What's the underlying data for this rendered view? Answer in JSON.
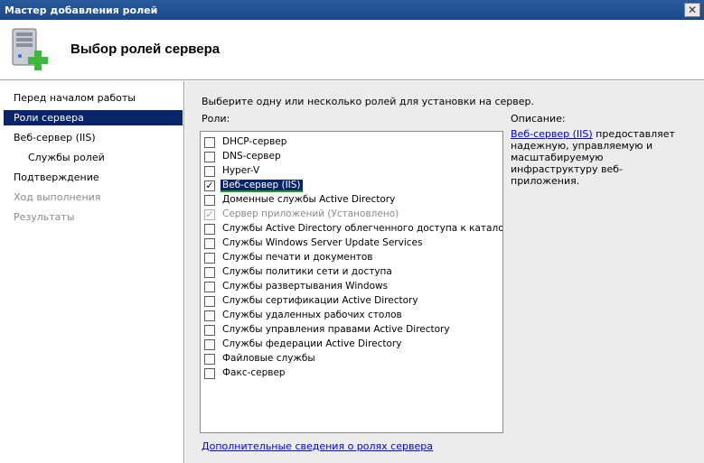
{
  "window": {
    "title": "Мастер добавления ролей",
    "close_glyph": "✕"
  },
  "header": {
    "title": "Выбор ролей сервера",
    "icon": "server-add-icon"
  },
  "nav": [
    {
      "label": "Перед началом работы",
      "state": "normal",
      "level": 0
    },
    {
      "label": "Роли сервера",
      "state": "active",
      "level": 0
    },
    {
      "label": "Веб-сервер (IIS)",
      "state": "normal",
      "level": 0
    },
    {
      "label": "Службы ролей",
      "state": "normal",
      "level": 1
    },
    {
      "label": "Подтверждение",
      "state": "normal",
      "level": 0
    },
    {
      "label": "Ход выполнения",
      "state": "disabled",
      "level": 0
    },
    {
      "label": "Результаты",
      "state": "disabled",
      "level": 0
    }
  ],
  "main": {
    "instruction": "Выберите одну или несколько ролей для установки на сервер.",
    "roles_label": "Роли:",
    "description_label": "Описание:",
    "description_link": "Веб-сервер (IIS)",
    "description_text": " предоставляет надежную, управляемую и масштабируемую инфраструктуру веб-приложения.",
    "more_link": "Дополнительные сведения о ролях сервера"
  },
  "roles": [
    {
      "label": "DHCP-сервер",
      "checked": false,
      "selected": false,
      "dimmed": false
    },
    {
      "label": "DNS-сервер",
      "checked": false,
      "selected": false,
      "dimmed": false
    },
    {
      "label": "Hyper-V",
      "checked": false,
      "selected": false,
      "dimmed": false
    },
    {
      "label": "Веб-сервер (IIS)",
      "checked": true,
      "selected": true,
      "dimmed": false
    },
    {
      "label": "Доменные службы Active Directory",
      "checked": false,
      "selected": false,
      "dimmed": false
    },
    {
      "label": "Сервер приложений (Установлено)",
      "checked": true,
      "selected": false,
      "dimmed": true
    },
    {
      "label": "Службы Active Directory облегченного доступа к каталогам",
      "checked": false,
      "selected": false,
      "dimmed": false
    },
    {
      "label": "Службы Windows Server Update Services",
      "checked": false,
      "selected": false,
      "dimmed": false
    },
    {
      "label": "Службы печати и документов",
      "checked": false,
      "selected": false,
      "dimmed": false
    },
    {
      "label": "Службы политики сети и доступа",
      "checked": false,
      "selected": false,
      "dimmed": false
    },
    {
      "label": "Службы развертывания Windows",
      "checked": false,
      "selected": false,
      "dimmed": false
    },
    {
      "label": "Службы сертификации Active Directory",
      "checked": false,
      "selected": false,
      "dimmed": false
    },
    {
      "label": "Службы удаленных рабочих столов",
      "checked": false,
      "selected": false,
      "dimmed": false
    },
    {
      "label": "Службы управления правами Active Directory",
      "checked": false,
      "selected": false,
      "dimmed": false
    },
    {
      "label": "Службы федерации Active Directory",
      "checked": false,
      "selected": false,
      "dimmed": false
    },
    {
      "label": "Файловые службы",
      "checked": false,
      "selected": false,
      "dimmed": false
    },
    {
      "label": "Факс-сервер",
      "checked": false,
      "selected": false,
      "dimmed": false
    }
  ],
  "check_glyph": "✓",
  "colors": {
    "titlebar": "#1a4a8a",
    "selection": "#0a246a",
    "link": "#0000cc",
    "focus_underline": "#18a018"
  }
}
